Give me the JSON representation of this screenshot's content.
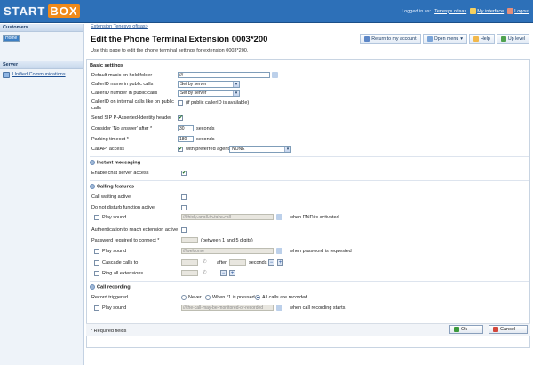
{
  "brand": {
    "part1": "START",
    "part2": "BOX"
  },
  "topbar": {
    "logged_in_label": "Logged in as:",
    "user": "Tenesys ofisas",
    "my_interface": "My interface",
    "logout": "Logout"
  },
  "sidebar": {
    "customers_header": "Customers",
    "home_label": "Home",
    "server_header": "Server",
    "unified_label": "Unified Communications"
  },
  "breadcrumb": "Extension Tenesys ofisas>",
  "page_title": "Edit the Phone Terminal Extension 0003*200",
  "page_note": "Use this page to edit the phone terminal settings for extension 0003*200.",
  "toolbar": {
    "return_label": "Return to my account",
    "open_menu_label": "Open menu",
    "help_label": "Help",
    "up_label": "Up level"
  },
  "basic": {
    "header": "Basic settings",
    "moh_label": "Default music on hold folder",
    "moh_value": "///",
    "cid_name_label": "CallerID name in public calls",
    "cid_name_value": "Set by server",
    "cid_number_label": "CallerID number in public calls",
    "cid_number_value": "Set by server",
    "cid_internal_label": "CallerID on internal calls like on public calls",
    "cid_internal_note": "(if public callerID is available)",
    "sip_label": "Send SIP P-Asserted-Identity header",
    "noanswer_label": "Consider 'No answer' after *",
    "noanswer_value": "30",
    "noanswer_unit": "seconds",
    "parking_label": "Parking timeout *",
    "parking_value": "180",
    "parking_unit": "seconds",
    "callapi_label": "CallAPI access",
    "callapi_note": "with preferred agent",
    "callapi_value": "NONE"
  },
  "im": {
    "header": "Instant messaging",
    "chat_label": "Enable chat server access"
  },
  "calling": {
    "header": "Calling features",
    "waiting_label": "Call waiting active",
    "dnd_label": "Do not disturb function active",
    "dnd_play_label": "Play sound",
    "dnd_sound_value": "///thisly-anall-to-take-call",
    "dnd_note": "when DND is activated",
    "auth_label": "Authentication to reach extension active",
    "password_label": "Password required to connect *",
    "password_note": "(between 1 and 5 digits)",
    "pw_play_label": "Play sound",
    "pw_sound_value": "///welcome",
    "pw_note": "when password is requested",
    "cascade_label": "Cascade calls to",
    "cascade_after": "after",
    "cascade_unit": "seconds",
    "ring_all_label": "Ring all extensions"
  },
  "recording": {
    "header": "Call recording",
    "triggered_label": "Record triggered",
    "opt_never": "Never",
    "opt_when": "When *1 is pressed",
    "opt_all": "All calls are recorded",
    "play_label": "Play sound",
    "sound_value": "///the-call-may-be-monitored-or-recorded",
    "note": "when call recording starts."
  },
  "required_note": "* Required fields",
  "buttons": {
    "ok": "Ok",
    "cancel": "Cancel"
  },
  "colors": {
    "topbar": "#2d70b8",
    "accent_orange": "#f08a1a",
    "link": "#1d4f93"
  }
}
